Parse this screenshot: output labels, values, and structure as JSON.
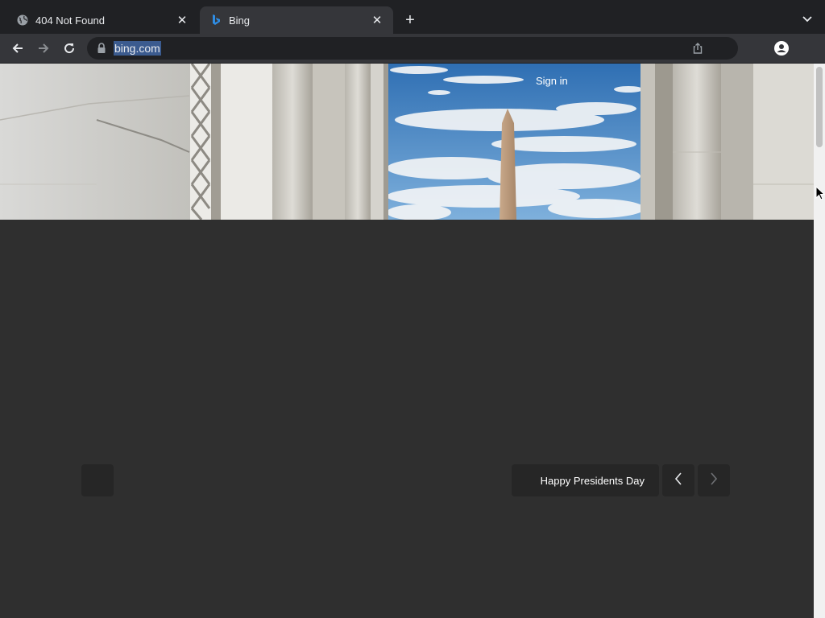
{
  "browser": {
    "tabs": [
      {
        "title": "404 Not Found",
        "icon": "globe-icon",
        "close": "✕"
      },
      {
        "title": "Bing",
        "icon": "bing-logo-icon",
        "close": "✕"
      }
    ],
    "new_tab": "+",
    "url": "bing.com"
  },
  "page": {
    "sign_in": "Sign in",
    "image_caption": "Happy Presidents Day"
  },
  "colors": {
    "tab_strip": "#202124",
    "toolbar": "#35363a",
    "page_background": "#2f2f2f",
    "button_background": "#262626",
    "url_highlight": "#3b5b8f"
  }
}
